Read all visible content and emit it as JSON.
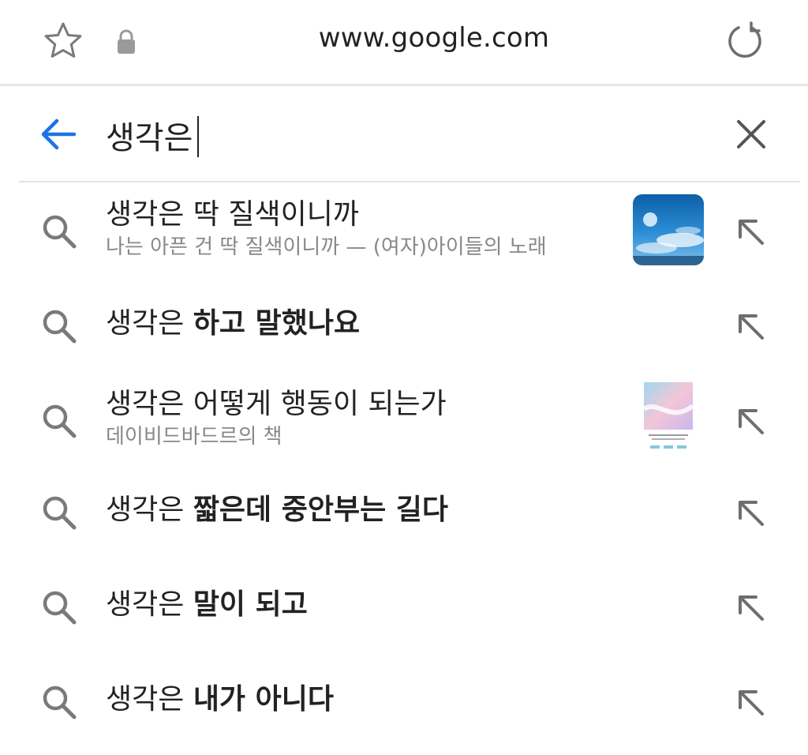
{
  "address_bar": {
    "url": "www.google.com"
  },
  "search": {
    "query": "생각은"
  },
  "suggestions": [
    {
      "prefix": "생각은 딱 질색이니까",
      "bold": "",
      "subtitle": "나는 아픈 건 딱 질색이니까 — (여자)아이들의 노래",
      "has_thumbnail": true,
      "thumbnail": "album-cover"
    },
    {
      "prefix": "생각은 ",
      "bold": "하고 말했나요",
      "subtitle": "",
      "has_thumbnail": false
    },
    {
      "prefix": "생각은 어떻게 행동이 되는가",
      "bold": "",
      "subtitle": "데이비드바드르의 책",
      "has_thumbnail": true,
      "thumbnail": "book-cover"
    },
    {
      "prefix": "생각은 ",
      "bold": "짧은데 중안부는 길다",
      "subtitle": "",
      "has_thumbnail": false
    },
    {
      "prefix": "생각은 ",
      "bold": "말이 되고",
      "subtitle": "",
      "has_thumbnail": false
    },
    {
      "prefix": "생각은 ",
      "bold": "내가 아니다",
      "subtitle": "",
      "has_thumbnail": false
    }
  ],
  "icons": {
    "bookmark": "star-icon",
    "secure": "lock-icon",
    "reload": "reload-icon",
    "back": "back-arrow-icon",
    "clear": "close-icon",
    "suggestion": "search-icon",
    "fill": "arrow-up-left-icon"
  },
  "colors": {
    "accent": "#1a73e8",
    "icon_gray": "#7a7a7a",
    "text": "#222222",
    "subtext": "#888888"
  }
}
